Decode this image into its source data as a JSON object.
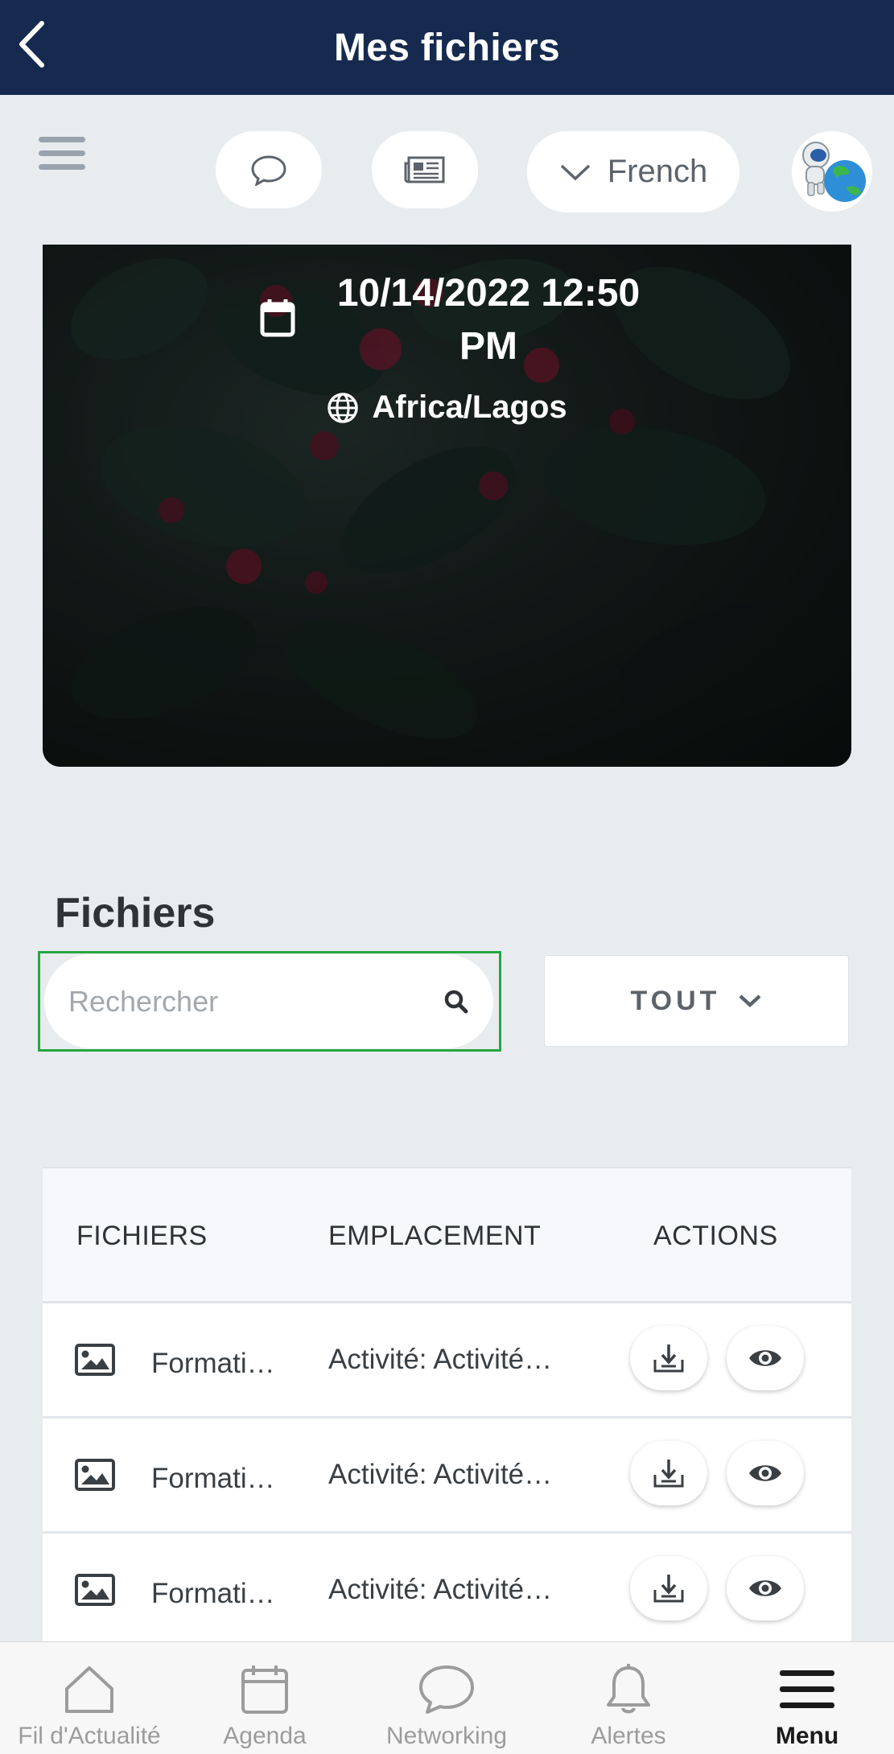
{
  "header": {
    "title": "Mes fichiers",
    "back_icon": "chevron-left-icon"
  },
  "toolbar": {
    "menu_icon": "hamburger-icon",
    "chat_icon": "chat-bubble-icon",
    "news_icon": "newspaper-icon",
    "language": "French",
    "language_icon": "chevron-down-icon"
  },
  "event": {
    "date_line1": "10/14/2022 12:50",
    "date_line2": "PM",
    "timezone": "Africa/Lagos"
  },
  "files": {
    "section_title": "Fichiers",
    "search_placeholder": "Rechercher",
    "filter_label": "TOUT",
    "columns": [
      "FICHIERS",
      "EMPLACEMENT",
      "ACTIONS"
    ],
    "rows": [
      {
        "name": "Formatio…",
        "location": "Activité: Activité…"
      },
      {
        "name": "Formatio…",
        "location": "Activité: Activité…"
      },
      {
        "name": "Formatio…",
        "location": "Activité: Activité…"
      }
    ]
  },
  "tabbar": {
    "items": [
      {
        "label": "Fil d'Actualité",
        "icon": "home-icon"
      },
      {
        "label": "Agenda",
        "icon": "calendar-icon"
      },
      {
        "label": "Networking",
        "icon": "chat-bubble-icon"
      },
      {
        "label": "Alertes",
        "icon": "bell-icon"
      },
      {
        "label": "Menu",
        "icon": "menu-icon"
      }
    ],
    "active": "Menu"
  },
  "colors": {
    "header_bg": "#162a4f",
    "page_bg": "#e9ecef",
    "search_focus": "#26a641"
  }
}
